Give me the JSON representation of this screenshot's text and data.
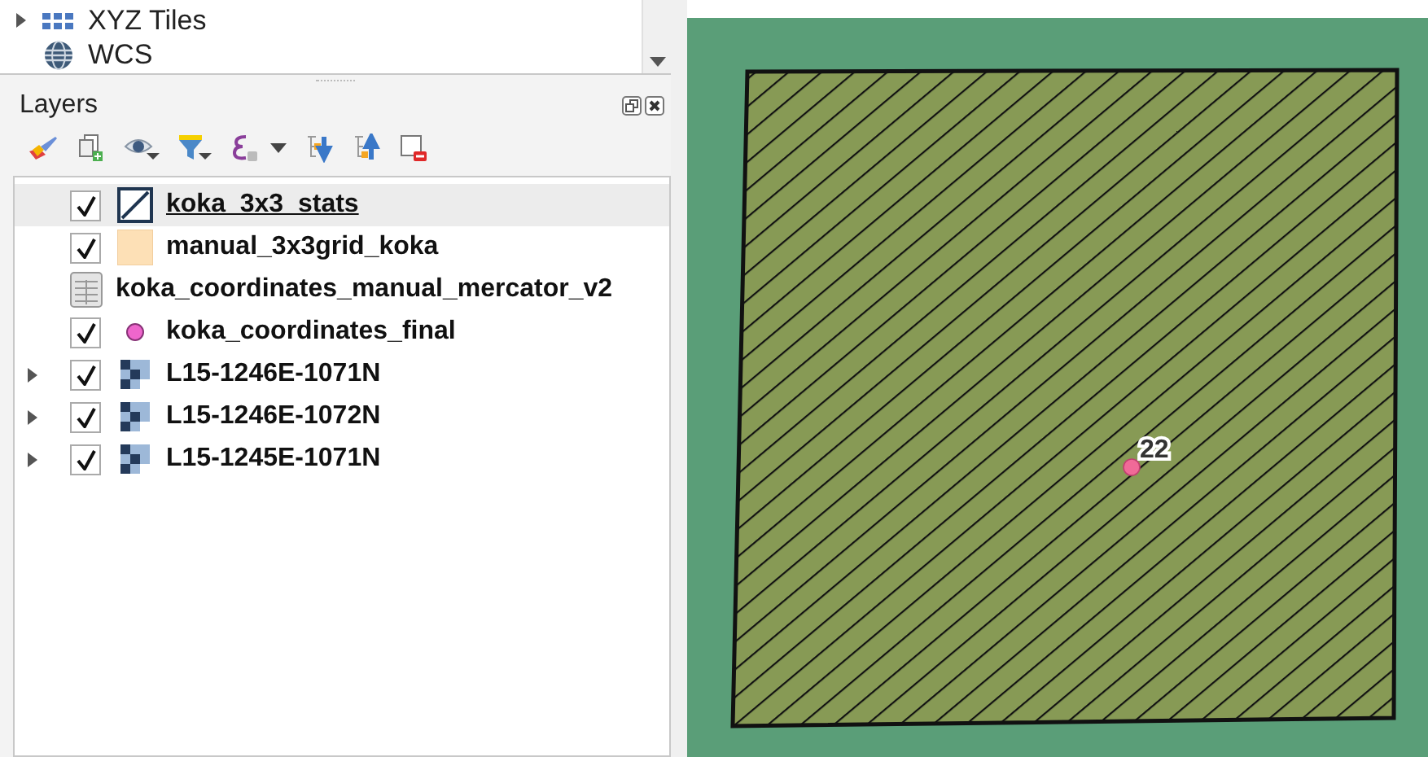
{
  "browser": {
    "items": [
      {
        "label": "XYZ Tiles",
        "kind": "tiles",
        "expandable": true
      },
      {
        "label": "WCS",
        "kind": "globe",
        "expandable": false
      }
    ]
  },
  "layers_panel": {
    "title": "Layers",
    "layers": [
      {
        "name": "koka_3x3_stats",
        "kind": "hatch",
        "checked": true,
        "selected": true,
        "expandable": false
      },
      {
        "name": "manual_3x3grid_koka",
        "kind": "fill",
        "checked": true,
        "selected": false,
        "expandable": false
      },
      {
        "name": "koka_coordinates_manual_mercator_v2",
        "kind": "table",
        "selected": false,
        "expandable": false
      },
      {
        "name": "koka_coordinates_final",
        "kind": "point",
        "checked": true,
        "selected": false,
        "expandable": false
      },
      {
        "name": "L15-1246E-1071N",
        "kind": "raster",
        "checked": true,
        "selected": false,
        "expandable": true
      },
      {
        "name": "L15-1246E-1072N",
        "kind": "raster",
        "checked": true,
        "selected": false,
        "expandable": true
      },
      {
        "name": "L15-1245E-1071N",
        "kind": "raster",
        "checked": true,
        "selected": false,
        "expandable": true
      }
    ]
  },
  "map": {
    "point_label": "22"
  }
}
